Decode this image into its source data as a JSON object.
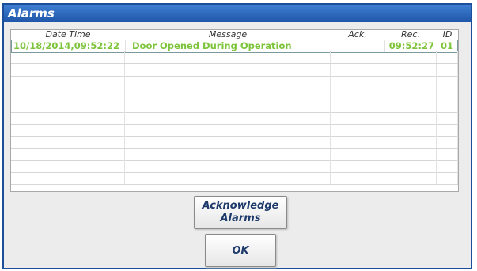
{
  "window": {
    "title": "Alarms"
  },
  "table": {
    "headers": [
      "Date Time",
      "Message",
      "Ack.",
      "Rec.",
      "ID"
    ],
    "rows": [
      [
        "10/18/2014,09:52:22",
        "Door Opened During Operation",
        "",
        "09:52:27",
        "01"
      ],
      [
        "",
        "",
        "",
        "",
        ""
      ],
      [
        "",
        "",
        "",
        "",
        ""
      ],
      [
        "",
        "",
        "",
        "",
        ""
      ],
      [
        "",
        "",
        "",
        "",
        ""
      ],
      [
        "",
        "",
        "",
        "",
        ""
      ],
      [
        "",
        "",
        "",
        "",
        ""
      ],
      [
        "",
        "",
        "",
        "",
        ""
      ],
      [
        "",
        "",
        "",
        "",
        ""
      ],
      [
        "",
        "",
        "",
        "",
        ""
      ],
      [
        "",
        "",
        "",
        "",
        ""
      ],
      [
        "",
        "",
        "",
        "",
        ""
      ]
    ]
  },
  "buttons": {
    "acknowledge_line1": "Acknowledge",
    "acknowledge_line2": "Alarms",
    "ok": "OK"
  },
  "colors": {
    "title_bar": "#2a62b8",
    "alarm_text": "#7dc43a"
  }
}
